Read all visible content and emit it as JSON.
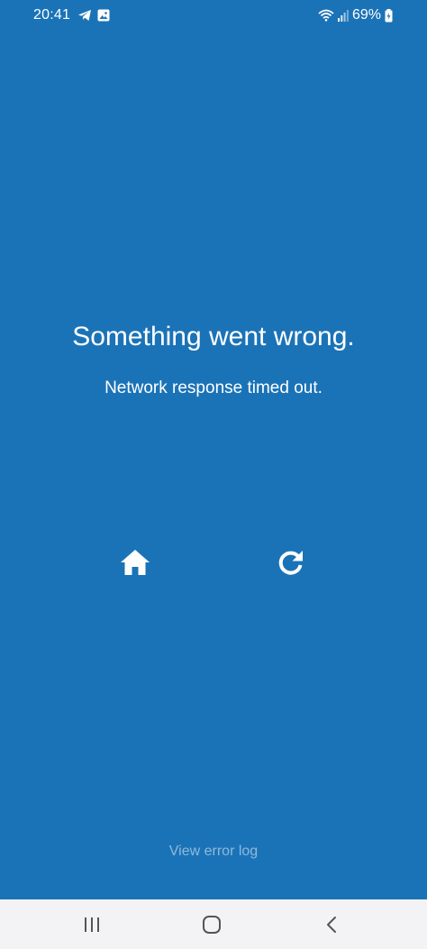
{
  "status_bar": {
    "time": "20:41",
    "battery_percent": "69%",
    "left_icons": [
      "telegram-icon",
      "gallery-icon"
    ],
    "right_icons": [
      "wifi-icon",
      "signal-icon",
      "battery-icon"
    ]
  },
  "error": {
    "title": "Something went wrong.",
    "message": "Network response timed out."
  },
  "actions": {
    "home_icon": "home-icon",
    "reload_icon": "reload-icon"
  },
  "footer": {
    "error_log_label": "View error log"
  },
  "nav_bar": {
    "buttons": [
      "recents-icon",
      "home-outline-icon",
      "back-icon"
    ]
  },
  "colors": {
    "background": "#1b73b7",
    "text": "#ffffff",
    "link": "#8fb9dc",
    "nav_background": "#f3f3f5",
    "nav_icon": "#555555"
  }
}
